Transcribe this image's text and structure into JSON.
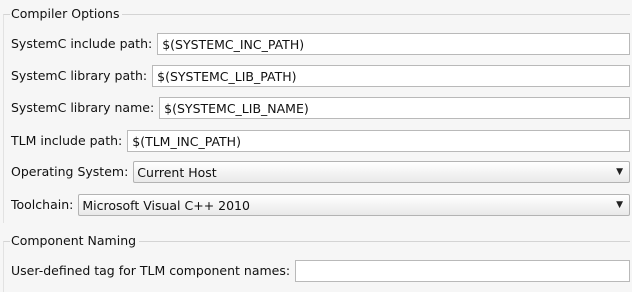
{
  "compiler_options": {
    "legend": "Compiler Options",
    "systemc_include_path": {
      "label": "SystemC include path:",
      "value": "$(SYSTEMC_INC_PATH)"
    },
    "systemc_library_path": {
      "label": "SystemC library path:",
      "value": "$(SYSTEMC_LIB_PATH)"
    },
    "systemc_library_name": {
      "label": "SystemC library name:",
      "value": "$(SYSTEMC_LIB_NAME)"
    },
    "tlm_include_path": {
      "label": "TLM include path:",
      "value": "$(TLM_INC_PATH)"
    },
    "operating_system": {
      "label": "Operating System:",
      "value": "Current Host",
      "icon": "chevron-down-icon"
    },
    "toolchain": {
      "label": "Toolchain:",
      "value": "Microsoft Visual C++ 2010",
      "icon": "chevron-down-icon"
    }
  },
  "component_naming": {
    "legend": "Component Naming",
    "tlm_component_tag": {
      "label": "User-defined tag for TLM component names:",
      "value": ""
    }
  }
}
